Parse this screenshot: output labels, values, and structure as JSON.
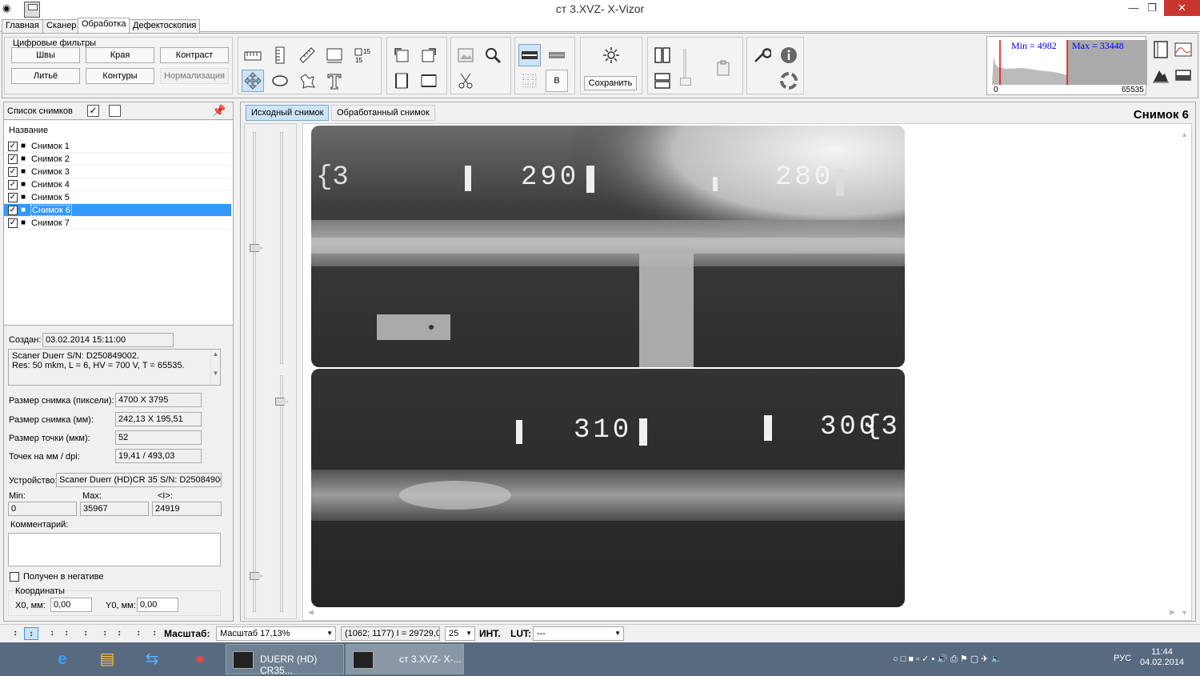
{
  "window": {
    "title": "ст 3.XVZ- X-Vizor"
  },
  "tabs": [
    {
      "label": "Главная"
    },
    {
      "label": "Сканер"
    },
    {
      "label": "Обработка"
    },
    {
      "label": "Дефектоскопия"
    }
  ],
  "filters": {
    "group_title": "Цифровые фильтры",
    "row1": [
      "Швы",
      "Края",
      "Контраст"
    ],
    "row2": [
      "Литьё",
      "Контуры",
      "Нормализация"
    ]
  },
  "toolbar": {
    "save_label": "Сохранить",
    "b_label": "B",
    "t_label": "T",
    "num15": "15"
  },
  "histogram": {
    "min_label": "Min = 4982",
    "max_label": "Max = 33448",
    "axis_min": "0",
    "axis_max": "65535"
  },
  "list_panel": {
    "title": "Список снимков",
    "column": "Название",
    "items": [
      {
        "label": "Снимок 1",
        "checked": true
      },
      {
        "label": "Снимок 2",
        "checked": true
      },
      {
        "label": "Снимок 3",
        "checked": true
      },
      {
        "label": "Снимок 4",
        "checked": true
      },
      {
        "label": "Снимок 5",
        "checked": true
      },
      {
        "label": "Снимок 6",
        "checked": true,
        "selected": true
      },
      {
        "label": "Снимок 7",
        "checked": true
      }
    ]
  },
  "props": {
    "created_label": "Создан:",
    "created_value": "03.02.2014 15:11:00",
    "desc_line1": "Scaner Duerr S/N: D250849002.",
    "desc_line2": "Res: 50 mkm, L = 6, HV = 700 V, T = 65535.",
    "size_px_label": "Размер снимка (пиксели):",
    "size_px_value": "4700 X 3795",
    "size_mm_label": "Размер снимка (мм):",
    "size_mm_value": "242,13 X 195,51",
    "dot_label": "Размер точки (мкм):",
    "dot_value": "52",
    "dpi_label": "Точек на мм / dpi:",
    "dpi_value": "19,41 / 493,03",
    "device_label": "Устройство:",
    "device_value": "Scaner Duerr (HD)CR 35 S/N: D250849002",
    "min_label": "Min:",
    "max_label": "Max:",
    "avg_label": "<I>:",
    "min_value": "0",
    "max_value": "35967",
    "avg_value": "24919",
    "comment_label": "Комментарий:",
    "negative_label": "Получен в негативе",
    "coords_label": "Координаты",
    "x0_label": "X0, мм:",
    "x0_value": "0,00",
    "y0_label": "Y0, мм:",
    "y0_value": "0,00"
  },
  "view": {
    "tab_source": "Исходный снимок",
    "tab_processed": "Обработанный снимок",
    "title": "Снимок 6"
  },
  "xray_marks": {
    "top": [
      "{3",
      "290",
      "280"
    ],
    "bottom": [
      "310",
      "300",
      "{3"
    ]
  },
  "statusbar": {
    "scale_label": "Масштаб:",
    "scale_value": "Масштаб 17,13%",
    "coord_value": "(1062; 1177) I = 29729,0(",
    "num_value": "25",
    "int_label": "ИНТ.",
    "lut_label": "LUT:",
    "lut_value": "---"
  },
  "taskbar": {
    "win1": "DUERR (HD) CR35...",
    "win2": "ст 3.XVZ- X-...",
    "lang": "РУС",
    "time": "11:44",
    "date": "04.02.2014"
  },
  "colors": {
    "accent": "#3399ff",
    "selected_tab": "#cde3f7",
    "close_red": "#c7372f",
    "taskbar": "#586a80",
    "histo_line": "#ff0000",
    "histo_text": "#0000ff"
  }
}
